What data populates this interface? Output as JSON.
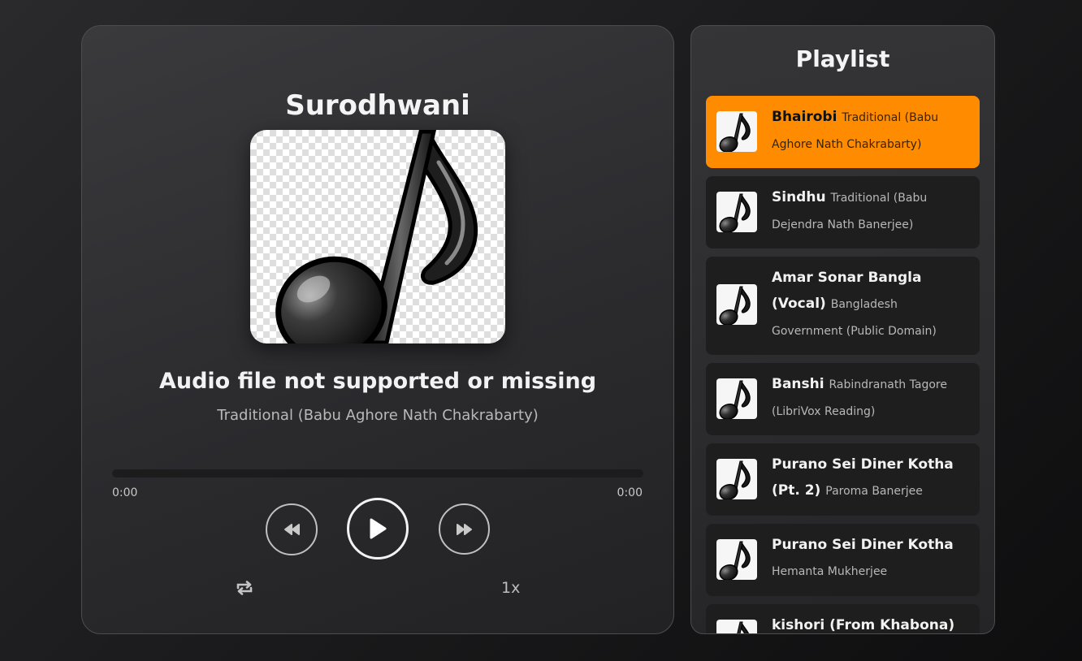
{
  "player": {
    "title": "Surodhwani",
    "art_icon": "music-note-icon",
    "track_title": "Audio file not supported or missing",
    "track_artist": "Traditional (Babu Aghore Nath Chakrabarty)",
    "progress_fraction": 0,
    "current_time": "0:00",
    "duration": "0:00",
    "speed": "1x",
    "accent_color": "#ff8c00"
  },
  "playlist": {
    "title": "Playlist",
    "items": [
      {
        "name": "Bhairobi",
        "artist": "Traditional (Babu Aghore Nath Chakrabarty)"
      },
      {
        "name": "Sindhu",
        "artist": "Traditional (Babu Dejendra Nath Banerjee)"
      },
      {
        "name": "Amar Sonar Bangla (Vocal)",
        "artist": "Bangladesh Government (Public Domain)"
      },
      {
        "name": "Banshi",
        "artist": "Rabindranath Tagore (LibriVox Reading)"
      },
      {
        "name": "Purano Sei Diner Kotha (Pt. 2)",
        "artist": "Paroma Banerjee"
      },
      {
        "name": "Purano Sei Diner Kotha",
        "artist": "Hemanta Mukherjee"
      },
      {
        "name": "kishori (From Khabona)",
        "artist": ""
      }
    ]
  }
}
